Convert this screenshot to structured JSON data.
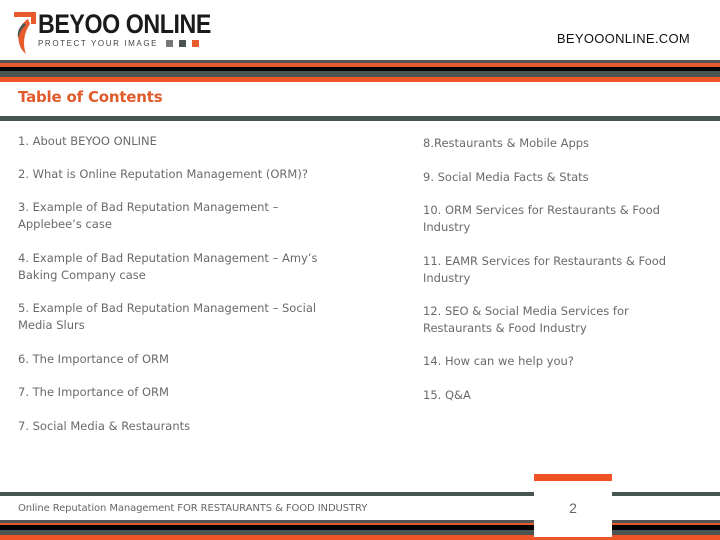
{
  "header": {
    "logo_name": "BEYOO ONLINE",
    "logo_tagline": "PROTECT YOUR IMAGE",
    "site_url": "BEYOOONLINE.COM"
  },
  "colors": {
    "accent_orange": "#e65a2b",
    "slate": "#465452",
    "stripe_gray": "#555555",
    "black": "#000000",
    "title_orange": "#e05a2b",
    "text_gray": "#6a6a6a"
  },
  "title": "Table of Contents",
  "toc": {
    "left": [
      "1. About BEYOO ONLINE",
      "2. What is Online Reputation Management (ORM)?",
      "3. Example of Bad Reputation Management – Applebee’s case",
      "4. Example of Bad Reputation Management – Amy’s Baking Company case",
      "5. Example of Bad Reputation Management – Social Media Slurs",
      "6. The Importance of ORM",
      "7. The Importance of ORM",
      "7. Social Media & Restaurants"
    ],
    "right": [
      "8.Restaurants & Mobile Apps",
      "9. Social Media Facts & Stats",
      "10. ORM Services for Restaurants & Food Industry",
      "11. EAMR Services for Restaurants & Food Industry",
      "12. SEO & Social Media Services for Restaurants & Food Industry",
      "14. How can we help you?",
      "15. Q&A"
    ]
  },
  "footer": {
    "text": "Online Reputation Management  FOR RESTAURANTS & FOOD INDUSTRY",
    "page_number": "2"
  }
}
